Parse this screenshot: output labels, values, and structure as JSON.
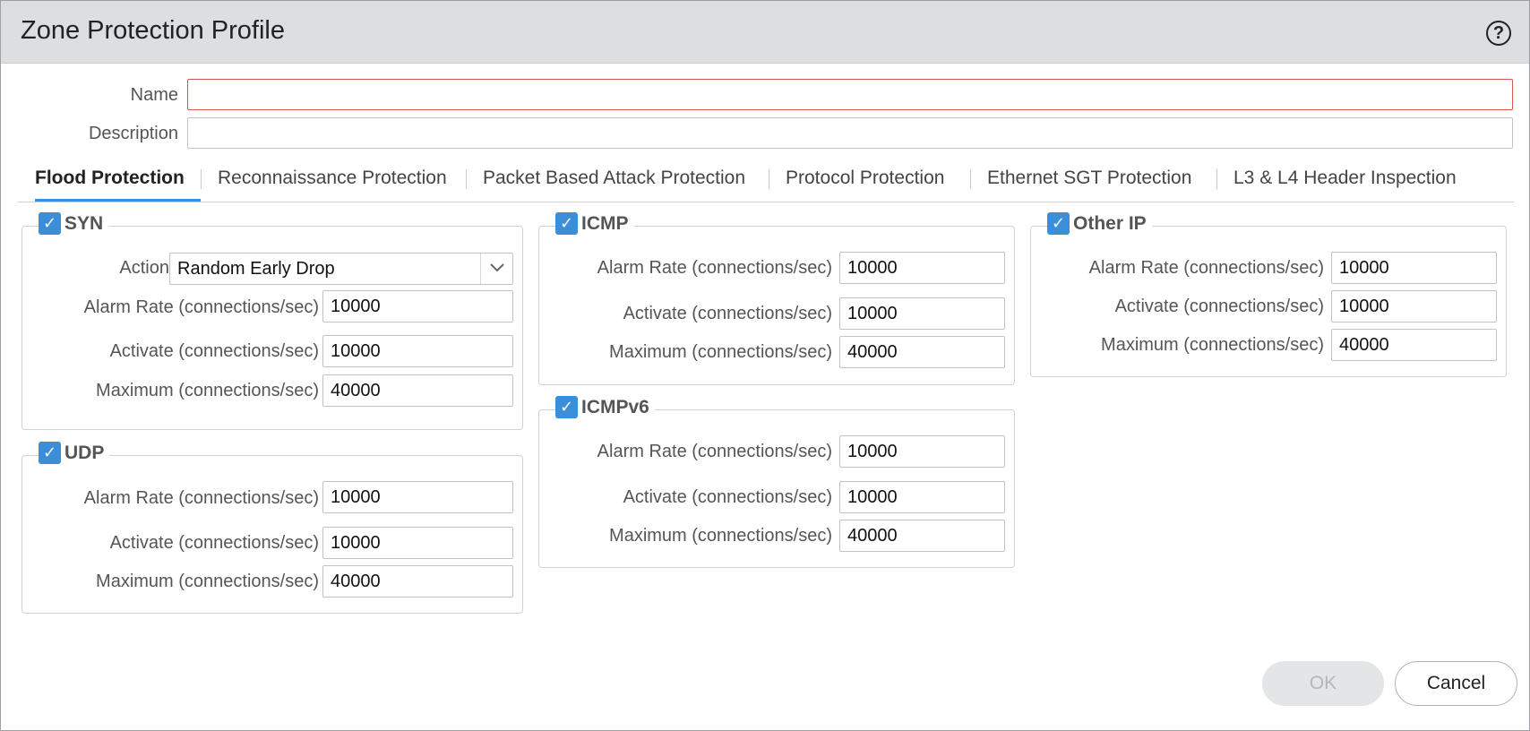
{
  "dialog": {
    "title": "Zone Protection Profile",
    "help_icon": "question-circle-icon"
  },
  "form": {
    "name_label": "Name",
    "name_value": "",
    "description_label": "Description",
    "description_value": ""
  },
  "tabs": [
    {
      "label": "Flood Protection",
      "active": true
    },
    {
      "label": "Reconnaissance Protection",
      "active": false
    },
    {
      "label": "Packet Based Attack Protection",
      "active": false
    },
    {
      "label": "Protocol Protection",
      "active": false
    },
    {
      "label": "Ethernet SGT Protection",
      "active": false
    },
    {
      "label": "L3 & L4 Header Inspection",
      "active": false
    }
  ],
  "flood": {
    "syn": {
      "label": "SYN",
      "checked": true,
      "action_label": "Action",
      "action_value": "Random Early Drop",
      "alarm_label": "Alarm Rate (connections/sec)",
      "alarm_value": "10000",
      "activate_label": "Activate (connections/sec)",
      "activate_value": "10000",
      "maximum_label": "Maximum (connections/sec)",
      "maximum_value": "40000"
    },
    "udp": {
      "label": "UDP",
      "checked": true,
      "alarm_label": "Alarm Rate (connections/sec)",
      "alarm_value": "10000",
      "activate_label": "Activate (connections/sec)",
      "activate_value": "10000",
      "maximum_label": "Maximum (connections/sec)",
      "maximum_value": "40000"
    },
    "icmp": {
      "label": "ICMP",
      "checked": true,
      "alarm_label": "Alarm Rate (connections/sec)",
      "alarm_value": "10000",
      "activate_label": "Activate (connections/sec)",
      "activate_value": "10000",
      "maximum_label": "Maximum (connections/sec)",
      "maximum_value": "40000"
    },
    "icmpv6": {
      "label": "ICMPv6",
      "checked": true,
      "alarm_label": "Alarm Rate (connections/sec)",
      "alarm_value": "10000",
      "activate_label": "Activate (connections/sec)",
      "activate_value": "10000",
      "maximum_label": "Maximum (connections/sec)",
      "maximum_value": "40000"
    },
    "other_ip": {
      "label": "Other IP",
      "checked": true,
      "alarm_label": "Alarm Rate (connections/sec)",
      "alarm_value": "10000",
      "activate_label": "Activate (connections/sec)",
      "activate_value": "10000",
      "maximum_label": "Maximum (connections/sec)",
      "maximum_value": "40000"
    }
  },
  "buttons": {
    "ok_label": "OK",
    "ok_enabled": false,
    "cancel_label": "Cancel"
  },
  "colors": {
    "accent": "#3b8fd9",
    "error_border": "#d9534f",
    "title_bar": "#dcdee0"
  }
}
